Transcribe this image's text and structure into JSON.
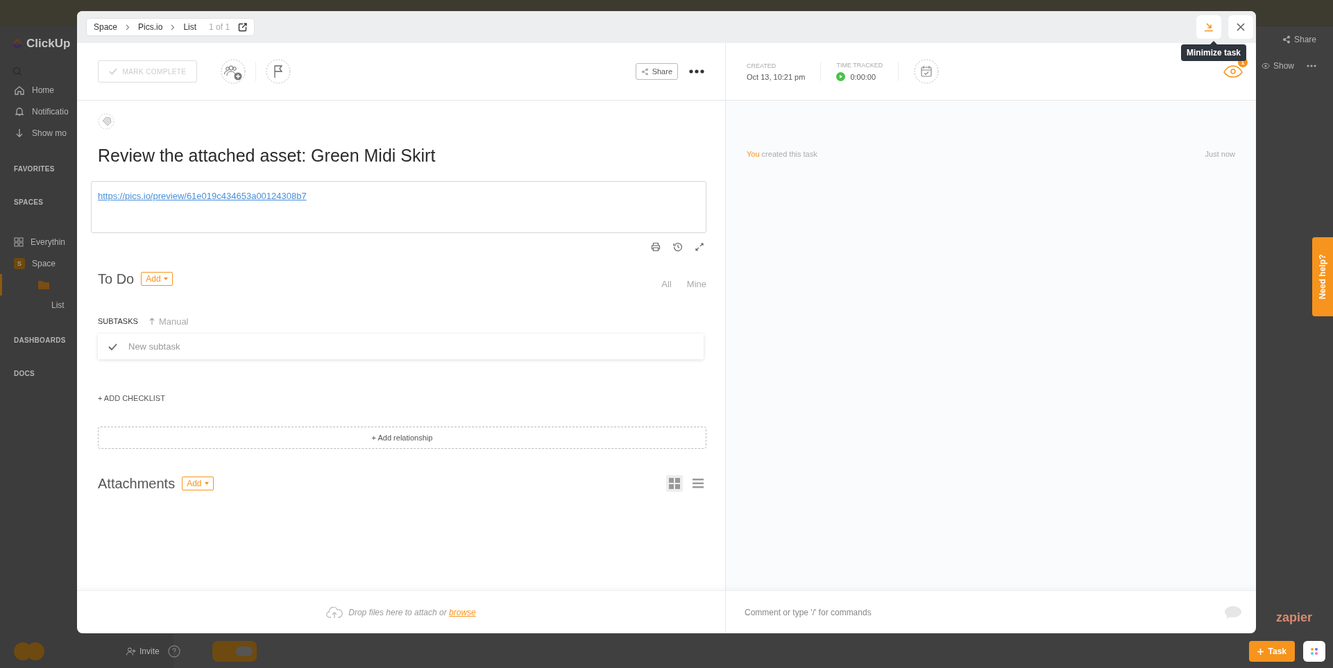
{
  "background_app": {
    "logo": "ClickUp",
    "sidebar": [
      {
        "kind": "nav",
        "label": "Home",
        "selected": false
      },
      {
        "kind": "nav",
        "label": "Notificatio",
        "selected": false
      },
      {
        "kind": "nav",
        "label": "Show mo",
        "selected": false
      },
      {
        "kind": "section",
        "label": "FAVORITES"
      },
      {
        "kind": "section",
        "label": "SPACES"
      },
      {
        "kind": "everything",
        "label": "Everythin",
        "selected": false
      },
      {
        "kind": "space",
        "label": "Space",
        "avatar": "S",
        "selected": false
      },
      {
        "kind": "folder",
        "selected": true
      },
      {
        "kind": "list",
        "label": "List",
        "selected": false
      },
      {
        "kind": "section",
        "label": "DASHBOARDS"
      },
      {
        "kind": "section",
        "label": "DOCS"
      }
    ],
    "invite": "Invite",
    "share": "Share",
    "show": "Show",
    "help_tab": "Need help?",
    "zapier": "zapier",
    "task_button": "Task"
  },
  "task": {
    "breadcrumb": [
      "Space",
      "Pics.io",
      "List"
    ],
    "position": "1 of 1",
    "tooltip": "Minimize task",
    "mark_complete": "MARK COMPLETE",
    "share": "Share",
    "created": {
      "label": "CREATED",
      "value": "Oct 13, 10:21 pm"
    },
    "time_tracked": {
      "label": "TIME TRACKED",
      "value": "0:00:00"
    },
    "watchers_badge": "1",
    "title": "Review the attached asset: Green Midi Skirt",
    "description_link": "https://pics.io/preview/61e019c434653a00124308b7",
    "status": {
      "label": "To Do",
      "add": "Add"
    },
    "filters": [
      "All",
      "Mine"
    ],
    "subtasks": {
      "label": "SUBTASKS",
      "sort": "Manual",
      "placeholder": "New subtask"
    },
    "add_checklist": "+ ADD CHECKLIST",
    "add_relationship": "+ Add relationship",
    "attachments": {
      "label": "Attachments",
      "add": "Add",
      "views": [
        {
          "kind": "grid",
          "selected": true
        },
        {
          "kind": "list",
          "selected": false
        }
      ]
    },
    "dropzone": {
      "text": "Drop files here to attach or",
      "link": "browse"
    },
    "activity": [
      {
        "actor": "You",
        "text": "created this task",
        "time": "Just now"
      }
    ],
    "comment": {
      "placeholder": "Comment or type '/' for commands"
    }
  }
}
